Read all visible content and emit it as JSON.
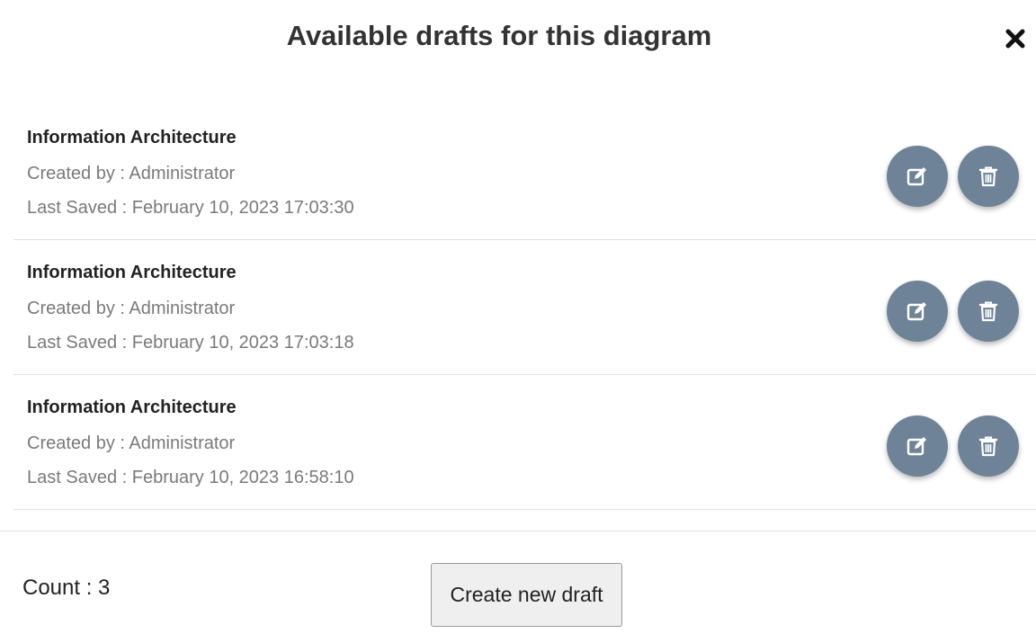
{
  "modal": {
    "title": "Available drafts for this diagram",
    "close_icon": "close-icon"
  },
  "drafts": [
    {
      "name": "Information Architecture",
      "created_by": "Created by : Administrator",
      "last_saved": "Last Saved : February 10, 2023 17:03:30"
    },
    {
      "name": "Information Architecture",
      "created_by": "Created by : Administrator",
      "last_saved": "Last Saved : February 10, 2023 17:03:18"
    },
    {
      "name": "Information Architecture",
      "created_by": "Created by : Administrator",
      "last_saved": "Last Saved : February 10, 2023 16:58:10"
    }
  ],
  "footer": {
    "count_label": "Count : 3",
    "create_button_label": "Create new draft"
  },
  "colors": {
    "action_button_bg": "#6e8397",
    "action_icon": "#ffffff"
  },
  "icons": {
    "edit": "edit-icon",
    "delete": "trash-icon"
  }
}
